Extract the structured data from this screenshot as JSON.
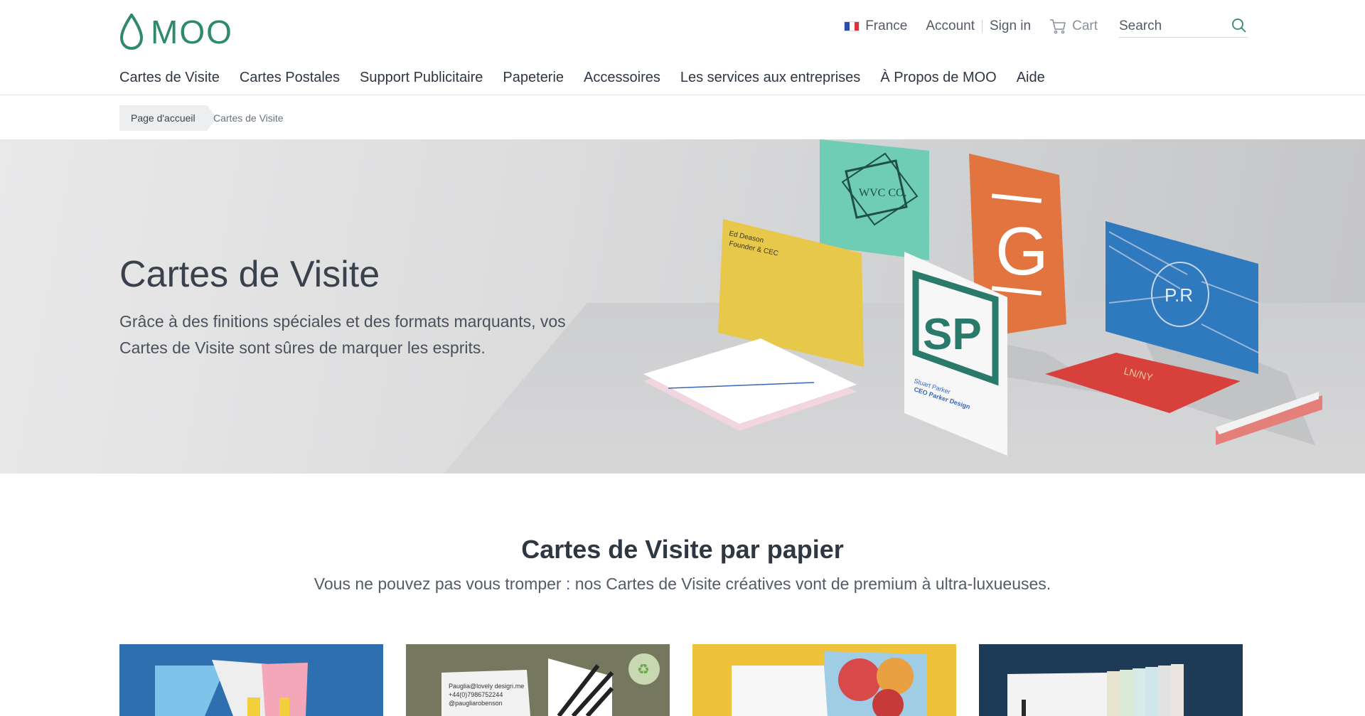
{
  "brand": {
    "name": "MOO",
    "color": "#2d8a6a"
  },
  "utility": {
    "country": "France",
    "account": "Account",
    "sign_in": "Sign in",
    "cart": "Cart",
    "search_placeholder": "Search"
  },
  "nav": {
    "items": [
      "Cartes de Visite",
      "Cartes Postales",
      "Support Publicitaire",
      "Papeterie",
      "Accessoires",
      "Les services aux entreprises",
      "À Propos de MOO",
      "Aide"
    ]
  },
  "breadcrumb": {
    "home": "Page d'accueil",
    "current": "Cartes de Visite"
  },
  "hero": {
    "title": "Cartes de Visite",
    "subtitle": "Grâce à des finitions spéciales et des formats marquants, vos Cartes de Visite sont sûres de marquer les esprits.",
    "cards": {
      "teal": "WVC CO.",
      "orange": "G",
      "blue": "P.R",
      "white_mono": "SP",
      "white_name": "Stuart Parker",
      "white_role": "CEO Parker Design",
      "yellow_name": "Ed Deason",
      "yellow_role": "Founder & CEC",
      "red": "LN/NY"
    }
  },
  "section": {
    "title": "Cartes de Visite par papier",
    "subtitle": "Vous ne pouvez pas vous tromper : nos Cartes de Visite créatives vont de premium à ultra-luxueuses."
  },
  "tiles": {
    "t2_email": "Pauglia@lovely design.me",
    "t2_phone": "+44(0)7986752244",
    "t2_handle": "@paugliarobenson"
  }
}
